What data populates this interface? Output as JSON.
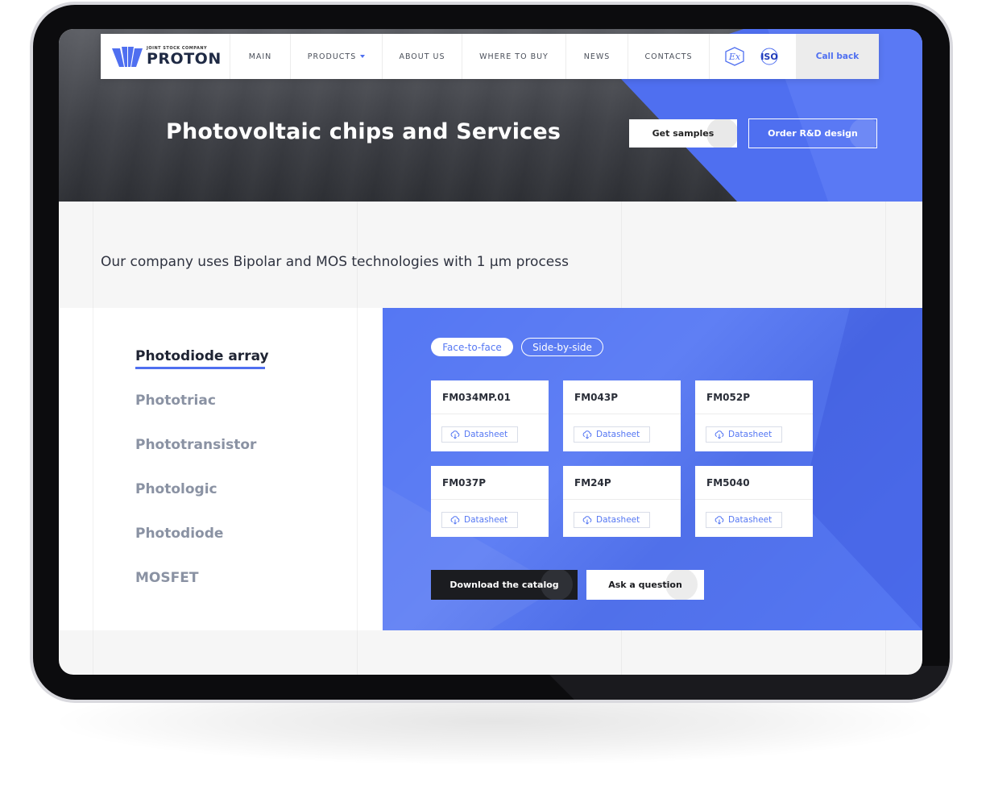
{
  "brand": {
    "company_type": "JOINT STOCK COMPANY",
    "name": "PROTON",
    "accent": "#4f6ff0"
  },
  "nav": {
    "items": [
      {
        "label": "MAIN"
      },
      {
        "label": "PRODUCTS"
      },
      {
        "label": "ABOUT US"
      },
      {
        "label": "WHERE TO BUY"
      },
      {
        "label": "NEWS"
      },
      {
        "label": "CONTACTS"
      }
    ],
    "icons": [
      "ex-certification-icon",
      "iso-icon"
    ],
    "iso_label": "ISO",
    "ex_label": "Ex",
    "callback_label": "Call back"
  },
  "hero": {
    "title": "Photovoltaic chips and Services",
    "samples_label": "Get samples",
    "order_label": "Order R&D design"
  },
  "tagline": "Our company uses Bipolar and MOS technologies with 1 μm process",
  "categories": [
    {
      "label": "Photodiode array",
      "active": true
    },
    {
      "label": "Phototriac"
    },
    {
      "label": "Phototransistor"
    },
    {
      "label": "Photologic"
    },
    {
      "label": "Photodiode"
    },
    {
      "label": "MOSFET"
    }
  ],
  "filters": {
    "face_to_face": "Face-to-face",
    "side_by_side": "Side-by-side"
  },
  "products": [
    {
      "name": "FM034MP.01",
      "datasheet": "Datasheet"
    },
    {
      "name": "FM043P",
      "datasheet": "Datasheet"
    },
    {
      "name": "FM052P",
      "datasheet": "Datasheet"
    },
    {
      "name": "FM037P",
      "datasheet": "Datasheet"
    },
    {
      "name": "FM24P",
      "datasheet": "Datasheet"
    },
    {
      "name": "FM5040",
      "datasheet": "Datasheet"
    }
  ],
  "actions": {
    "catalog_label": "Download the catalog",
    "ask_label": "Ask a question"
  }
}
